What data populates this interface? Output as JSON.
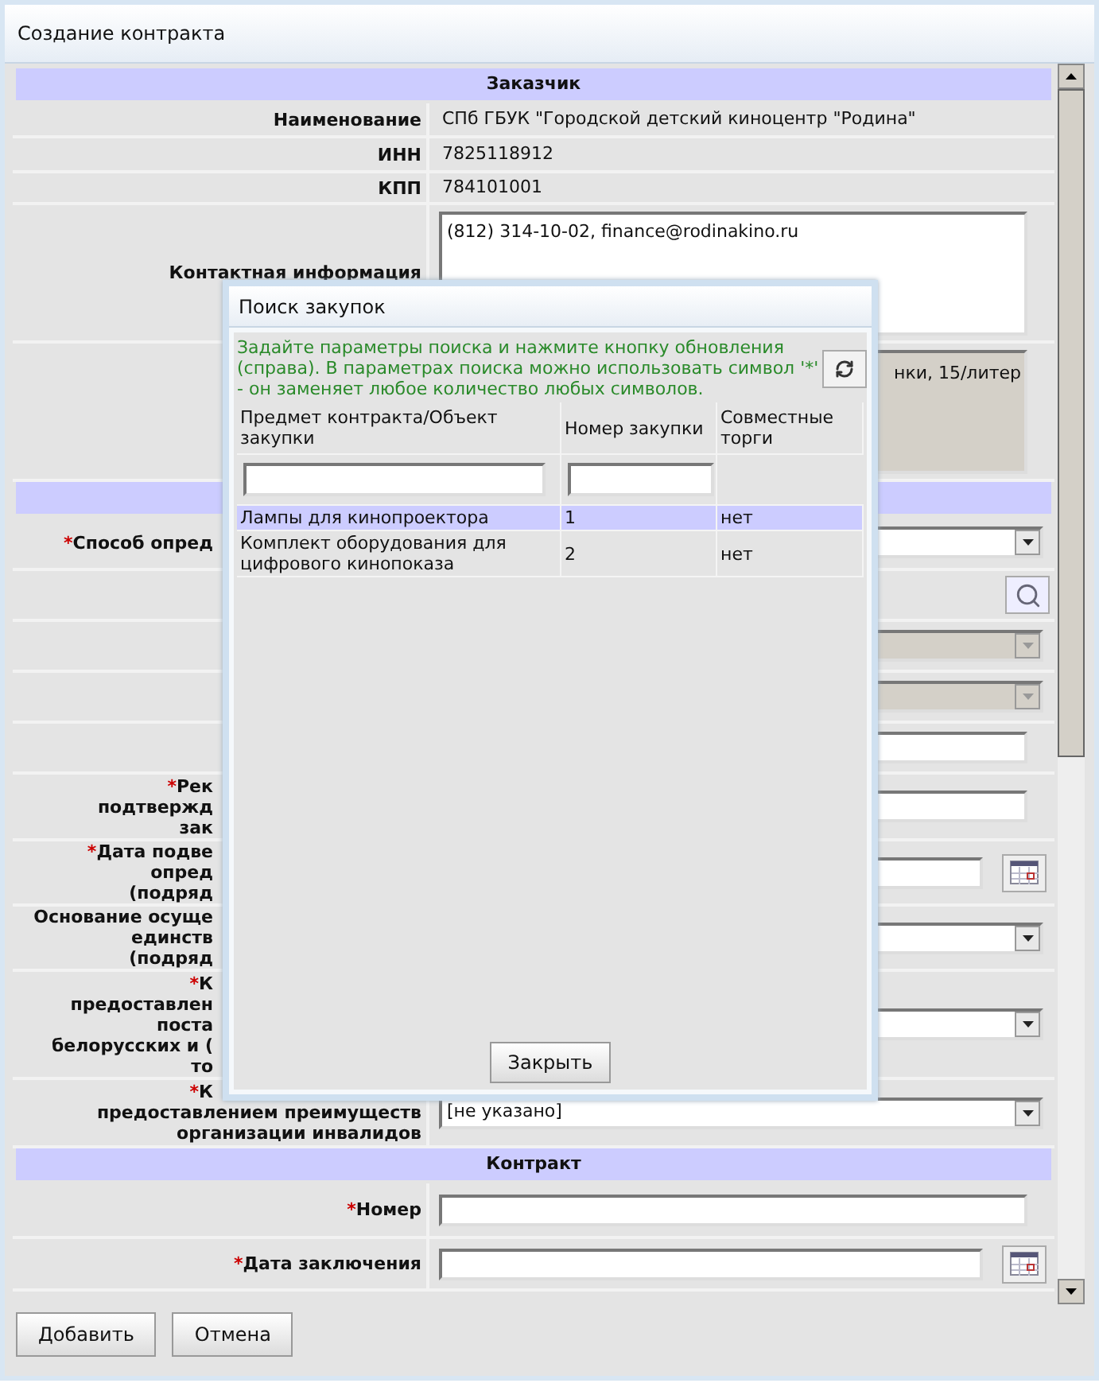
{
  "window": {
    "title": "Создание контракта"
  },
  "sections": [
    {
      "title": "Заказчик",
      "rows": [
        {
          "kind": "text",
          "label": [
            "Наименование"
          ],
          "value": "СПб ГБУК \"Городской детский киноцентр \"Родина\""
        },
        {
          "kind": "text",
          "label": [
            "ИНН"
          ],
          "value": "7825118912"
        },
        {
          "kind": "text",
          "label": [
            "КПП"
          ],
          "value": "784101001"
        },
        {
          "kind": "textarea",
          "label": [
            "Контактная информация"
          ],
          "value": "(812) 314-10-02, finance@rodinakino.ru",
          "disabled": false
        },
        {
          "kind": "textarea",
          "value": "нки, 15/литер",
          "disabled": true
        }
      ]
    },
    {
      "rows": [
        {
          "kind": "select",
          "marker": "*",
          "label": [
            "Способ опред"
          ],
          "disabled": false
        },
        {
          "kind": "search"
        },
        {
          "kind": "select",
          "disabled": true
        },
        {
          "kind": "select",
          "disabled": true
        },
        {
          "kind": "input"
        },
        {
          "kind": "input",
          "marker": "*",
          "label": [
            "Рек",
            "подтвержд",
            "зак"
          ]
        },
        {
          "kind": "date",
          "marker": "*",
          "label": [
            "Дата подве",
            "опред",
            "(подряд"
          ]
        },
        {
          "kind": "select",
          "label": [
            "Основание осуще",
            "единств",
            "(подряд"
          ],
          "disabled": false
        },
        {
          "kind": "select",
          "marker": "*",
          "label": [
            "К",
            "предоставлен",
            "постa",
            "белорусских и (",
            "то"
          ],
          "disabled": false
        },
        {
          "kind": "select",
          "marker": "*",
          "label": [
            "К",
            "предоставлением преимуществ",
            "организации инвалидов"
          ],
          "value": "[не указано]",
          "disabled": false
        }
      ]
    },
    {
      "title": "Контракт",
      "rows": [
        {
          "kind": "input",
          "marker": "*",
          "label": [
            "Номер"
          ]
        },
        {
          "kind": "date",
          "marker": "*",
          "label": [
            "Дата заключения"
          ]
        }
      ]
    }
  ],
  "buttons": [
    "Добавить",
    "Отмена"
  ],
  "dialog": {
    "title": "Поиск закупок",
    "hint": "Задайте параметры поиска и нажмите кнопку обновления (справа). В параметрах поиска можно использовать символ '*' - он заменяет любое количество любых символов.",
    "columns": [
      "Предмет контракта/Объект закупки",
      "Номер закупки",
      "Совместные торги"
    ],
    "rows": [
      {
        "cells": [
          "Лампы для кинопроектора",
          "1",
          "нет"
        ],
        "selected": true
      },
      {
        "cells": [
          "Комплект оборудования для цифрового кинопоказа",
          "2",
          "нет"
        ],
        "selected": false
      }
    ],
    "close_button": "Закрыть"
  }
}
